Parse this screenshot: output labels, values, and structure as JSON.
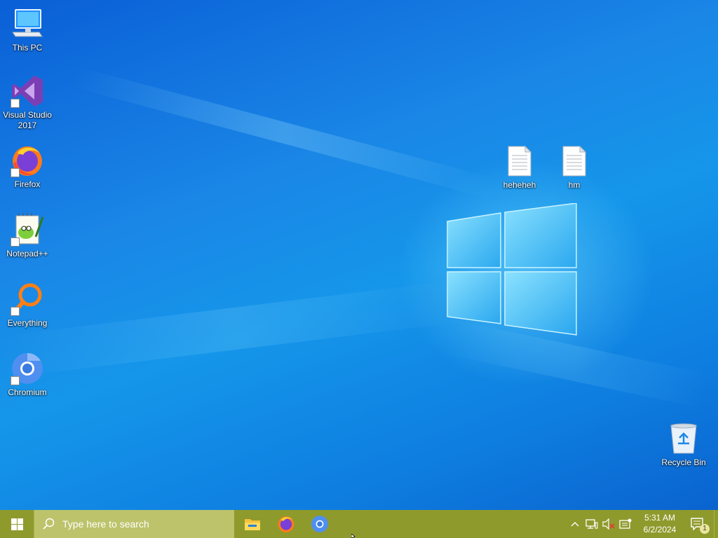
{
  "desktop": {
    "icons_left": [
      {
        "label": "This PC",
        "icon": "this-pc-icon"
      },
      {
        "label": "Visual Studio 2017",
        "icon": "visual-studio-icon"
      },
      {
        "label": "Firefox",
        "icon": "firefox-icon"
      },
      {
        "label": "Notepad++",
        "icon": "notepadpp-icon"
      },
      {
        "label": "Everything",
        "icon": "everything-icon"
      },
      {
        "label": "Chromium",
        "icon": "chromium-icon"
      }
    ],
    "files": [
      {
        "label": "heheheh",
        "icon": "text-file-icon"
      },
      {
        "label": "hm",
        "icon": "text-file-icon"
      }
    ],
    "recycle_bin": {
      "label": "Recycle Bin",
      "icon": "recycle-bin-icon"
    }
  },
  "taskbar": {
    "color": "#8f9a2c",
    "search_placeholder": "Type here to search",
    "pinned": [
      "file-explorer-icon",
      "firefox-icon",
      "chromium-icon"
    ],
    "tray": [
      "chevron-up-icon",
      "network-icon",
      "volume-muted-icon",
      "keyboard-icon"
    ],
    "clock": {
      "time": "5:31 AM",
      "date": "6/2/2024"
    },
    "notifications": {
      "count": "1"
    }
  }
}
